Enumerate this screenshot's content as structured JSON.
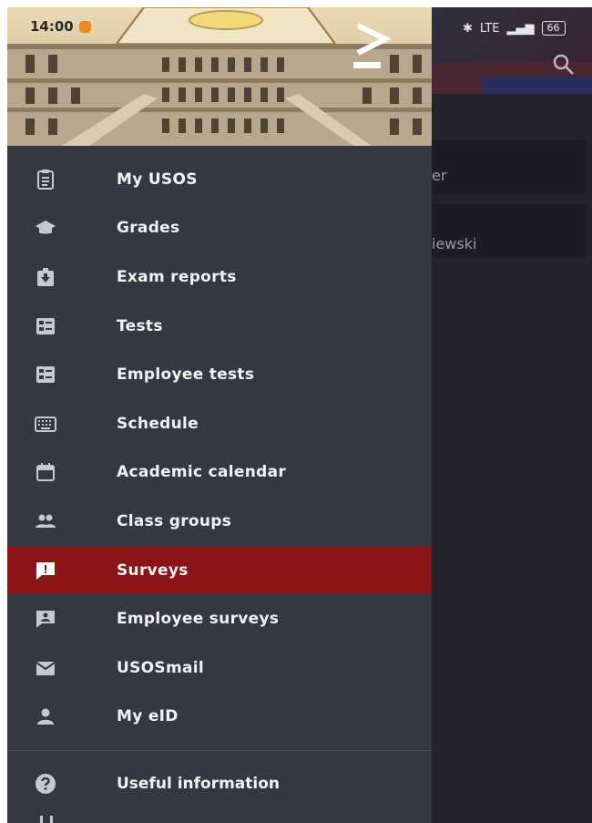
{
  "status_bar": {
    "time": "14:00",
    "network": "LTE",
    "battery": "66"
  },
  "background": {
    "card1_text": "er",
    "card2_text": "iewski"
  },
  "drawer": {
    "menu_items": [
      {
        "label": "My USOS",
        "icon": "clipboard-icon"
      },
      {
        "label": "Grades",
        "icon": "graduation-cap-icon"
      },
      {
        "label": "Exam reports",
        "icon": "download-box-icon"
      },
      {
        "label": "Tests",
        "icon": "test-list-icon"
      },
      {
        "label": "Employee tests",
        "icon": "test-list-icon"
      },
      {
        "label": "Schedule",
        "icon": "keyboard-grid-icon"
      },
      {
        "label": "Academic calendar",
        "icon": "calendar-icon"
      },
      {
        "label": "Class groups",
        "icon": "people-icon"
      },
      {
        "label": "Surveys",
        "icon": "feedback-icon",
        "active": true
      },
      {
        "label": "Employee surveys",
        "icon": "employee-feedback-icon"
      },
      {
        "label": "USOSmail",
        "icon": "mail-icon"
      },
      {
        "label": "My eID",
        "icon": "person-icon"
      }
    ],
    "extra_items": [
      {
        "label": "Useful information",
        "icon": "help-circle-icon"
      }
    ]
  },
  "colors": {
    "drawer_bg": "#353743",
    "active_bg": "#8b1516",
    "text": "#f2f2f4",
    "icon": "#c8c9d0"
  }
}
